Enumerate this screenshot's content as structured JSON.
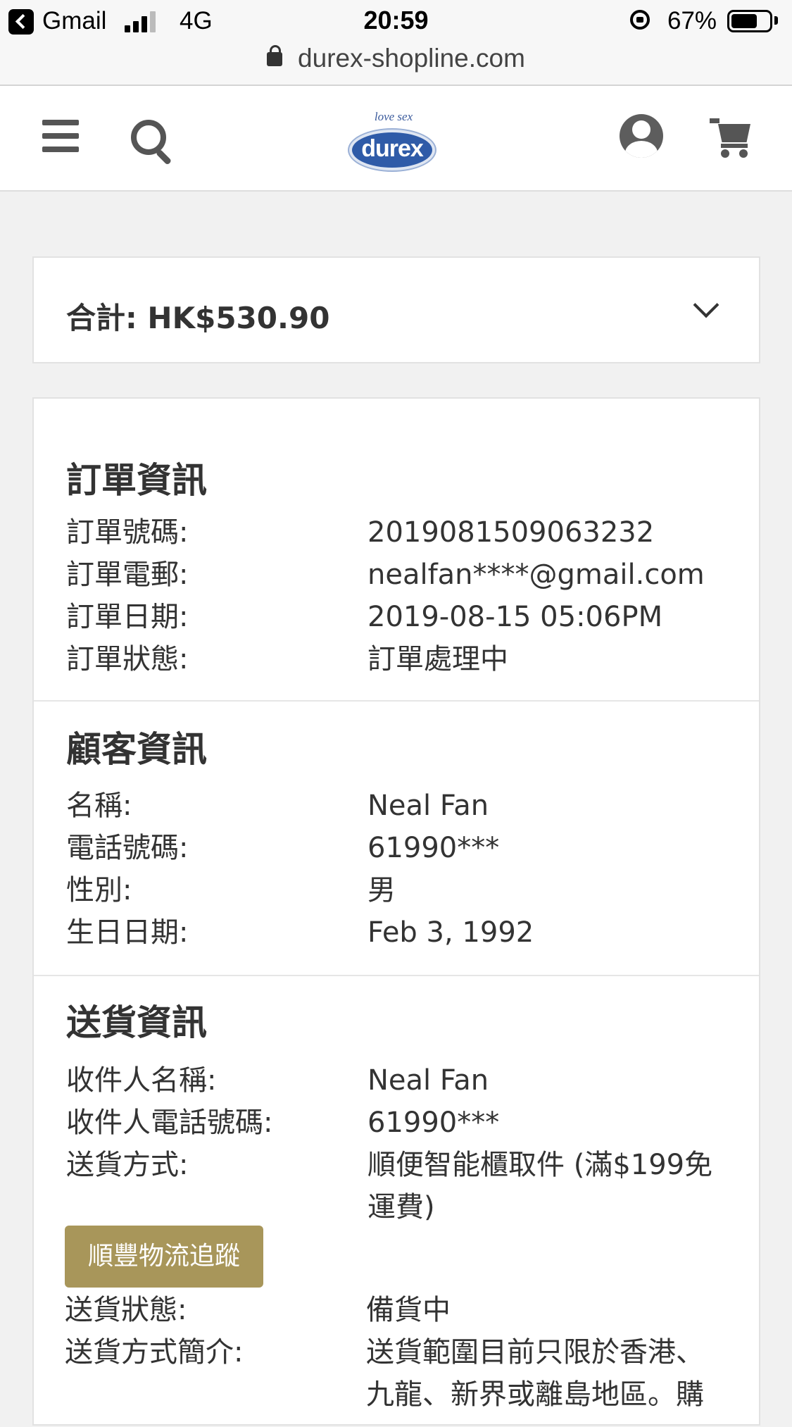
{
  "status_bar": {
    "back_app": "Gmail",
    "network": "4G",
    "time": "20:59",
    "battery": "67%"
  },
  "browser": {
    "url": "durex-shopline.com"
  },
  "header": {
    "logo_tagline": "love sex",
    "logo_brand": "durex"
  },
  "total": {
    "label": "合計: HK$530.90"
  },
  "order_info": {
    "title": "訂單資訊",
    "rows": [
      {
        "label": "訂單號碼:",
        "value": "2019081509063232"
      },
      {
        "label": "訂單電郵:",
        "value": "nealfan****@gmail.com"
      },
      {
        "label": "訂單日期:",
        "value": "2019-08-15 05:06PM"
      },
      {
        "label": "訂單狀態:",
        "value": "訂單處理中"
      }
    ]
  },
  "customer_info": {
    "title": "顧客資訊",
    "rows": [
      {
        "label": "名稱:",
        "value": "Neal Fan"
      },
      {
        "label": "電話號碼:",
        "value": "61990***"
      },
      {
        "label": "性別:",
        "value": "男"
      },
      {
        "label": "生日日期:",
        "value": "Feb 3, 1992"
      }
    ]
  },
  "delivery_info": {
    "title": "送貨資訊",
    "rows": [
      {
        "label": "收件人名稱:",
        "value": "Neal Fan"
      },
      {
        "label": "收件人電話號碼:",
        "value": "61990***"
      },
      {
        "label": "送貨方式:",
        "value": "順便智能櫃取件 (滿$199免運費)"
      }
    ],
    "tracking_button": "順豐物流追蹤",
    "rows_after": [
      {
        "label": "送貨狀態:",
        "value": "備貨中"
      },
      {
        "label": "送貨方式簡介:",
        "value": "送貨範圍目前只限於香港、九龍、新界或離島地區。購"
      }
    ]
  }
}
